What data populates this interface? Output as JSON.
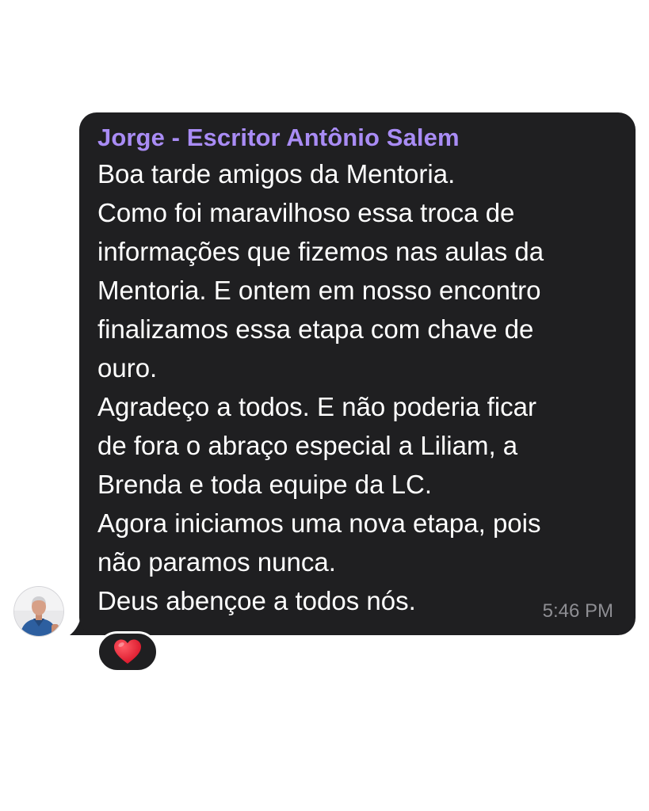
{
  "message": {
    "sender": "Jorge - Escritor Antônio Salem",
    "lines": [
      "Boa tarde amigos da Mentoria.",
      "Como foi maravilhoso essa troca de",
      "informações que fizemos nas aulas da",
      "Mentoria. E ontem em nosso encontro",
      "finalizamos essa etapa com chave de",
      "ouro.",
      "Agradeço a todos. E não poderia ficar",
      "de fora o abraço especial a Liliam, a",
      "Brenda e toda equipe da LC.",
      "Agora iniciamos uma nova etapa, pois",
      "não paramos nunca.",
      "Deus abençoe a todos nós."
    ],
    "time": "5:46 PM",
    "reaction_icon": "heart-icon"
  },
  "colors": {
    "bubble": "#1f1f21",
    "sender_name": "#a98cf5",
    "message_text": "#ffffff",
    "timestamp": "#8e8e93",
    "heart": "#e8132c"
  }
}
